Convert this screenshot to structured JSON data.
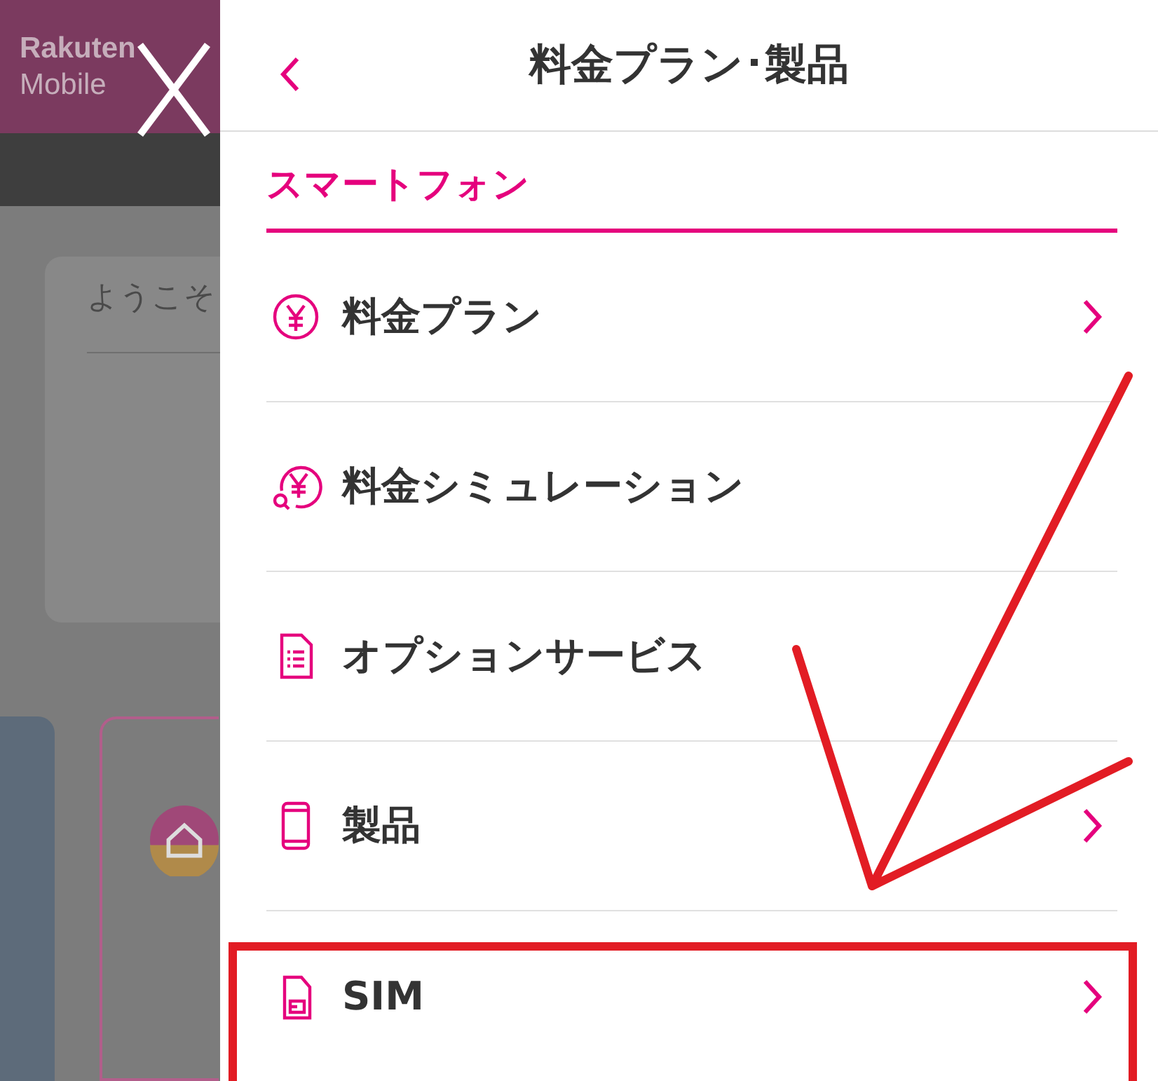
{
  "background": {
    "logo_line_1": "Rakuten",
    "logo_line_2": "Mobile",
    "welcome": "ようこそ"
  },
  "panel": {
    "title": "料金プラン･製品",
    "section": "スマートフォン",
    "items": [
      {
        "label": "料金プラン",
        "kind": "yen",
        "chevron": true,
        "highlighted": false
      },
      {
        "label": "料金シミュレーション",
        "kind": "yen-search",
        "chevron": false,
        "highlighted": false
      },
      {
        "label": "オプションサービス",
        "kind": "document",
        "chevron": false,
        "highlighted": false
      },
      {
        "label": "製品",
        "kind": "phone",
        "chevron": true,
        "highlighted": false
      },
      {
        "label": "SIM",
        "kind": "sim",
        "chevron": true,
        "highlighted": true
      }
    ]
  }
}
